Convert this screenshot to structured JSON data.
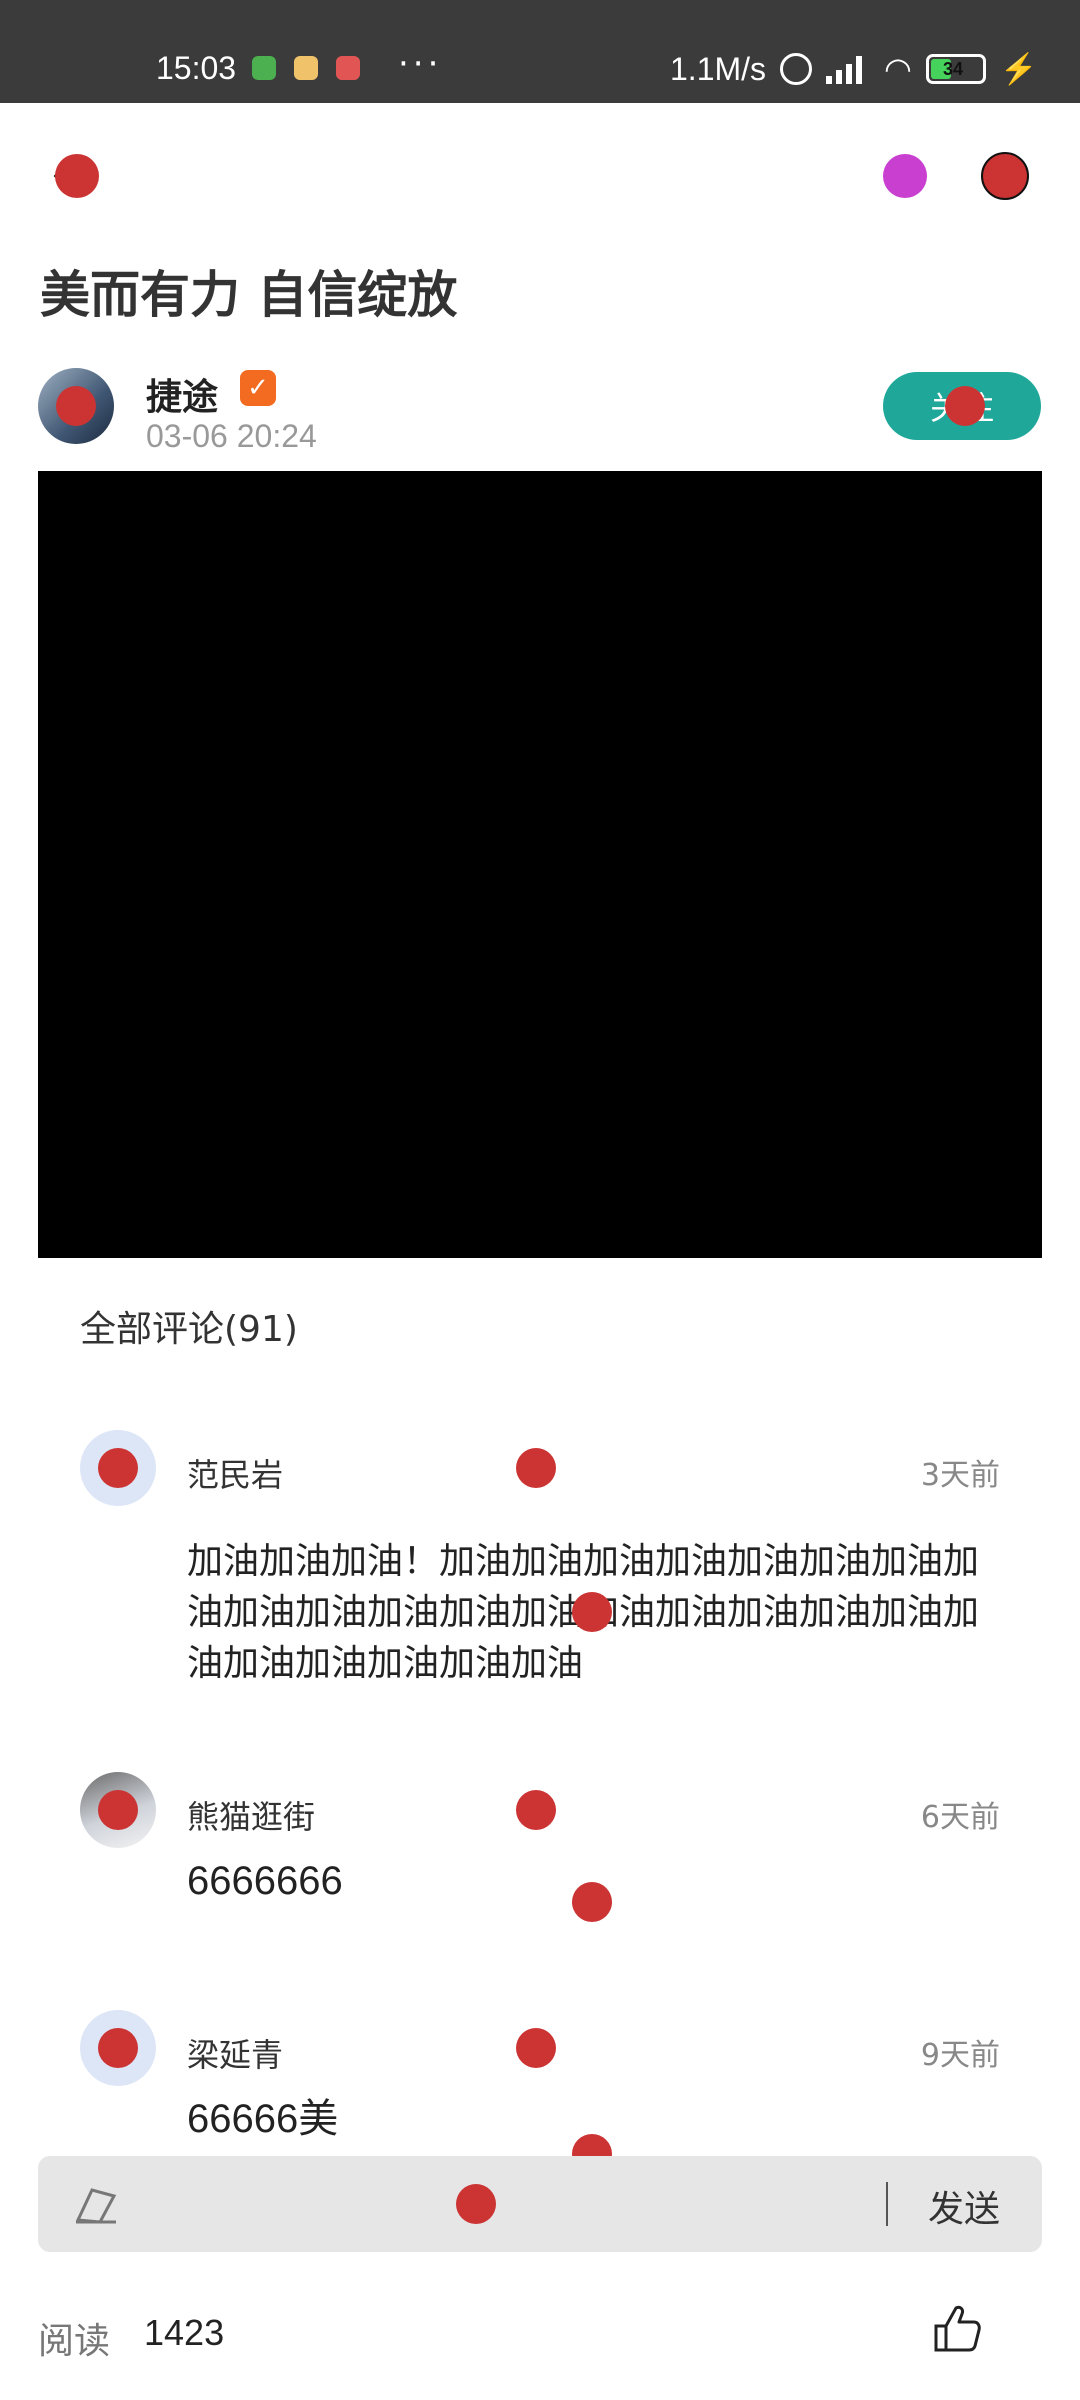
{
  "status_bar": {
    "time": "15:03",
    "network_speed": "1.1M/s",
    "battery_level": "34",
    "icons": [
      "app-icon",
      "app-icon",
      "app-icon",
      "more-dots-icon",
      "alarm-icon",
      "signal-icon",
      "wifi-icon",
      "battery-icon",
      "charging-icon"
    ]
  },
  "topbar": {
    "icons": [
      "back-icon",
      "share-icon",
      "more-icon"
    ]
  },
  "article": {
    "title": "美而有力 自信绽放",
    "author": "捷途",
    "verified_badge": "✓",
    "time": "03-06 20:24",
    "follow_label": "关注"
  },
  "comments": {
    "header": "全部评论(91)",
    "items": [
      {
        "name": "范民岩",
        "time": "3天前",
        "text": "加油加油加油！加油加油加油加油加油加油加油加油加油加油加油加油加油加油加油加油加油加油加油加油加油加油加油加油"
      },
      {
        "name": "熊猫逛街",
        "time": "6天前",
        "text": "6666666"
      },
      {
        "name": "梁延青",
        "time": "9天前",
        "text": "66666美"
      }
    ]
  },
  "input_bar": {
    "send_label": "发送"
  },
  "footer": {
    "read_label": "阅读",
    "read_count": "1423"
  },
  "colors": {
    "follow_button": "#1fa89a",
    "verified_badge": "#f36b21",
    "status_bar": "#3b3b3b",
    "marker": "#cc3333"
  }
}
